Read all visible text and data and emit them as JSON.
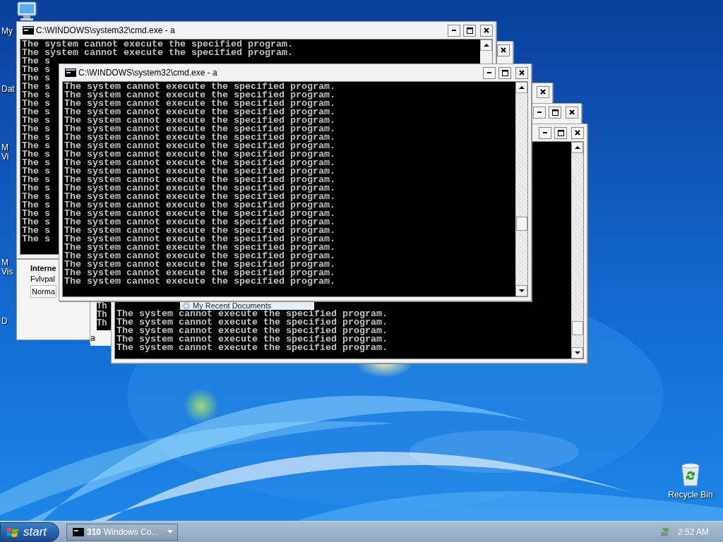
{
  "desktop": {
    "icon_labels": [
      {
        "lines": [
          "My"
        ]
      },
      {
        "lines": [
          "Dat"
        ]
      },
      {
        "lines": [
          "M",
          "Vi"
        ]
      },
      {
        "lines": [
          "M",
          "Vis"
        ]
      },
      {
        "lines": [
          "D"
        ]
      }
    ],
    "recycle_bin": {
      "label": "Recycle Bin"
    }
  },
  "windows": [
    {
      "buttons": [
        {
          "kind": "minimize"
        },
        {
          "kind": "maximize"
        },
        {
          "kind": "close"
        }
      ]
    },
    {
      "buttons": [
        {
          "kind": "close"
        }
      ]
    },
    {
      "buttons": [
        {
          "kind": "close"
        }
      ]
    },
    {
      "title": "C:\\WINDOWS\\system32\\cmd.exe - a",
      "buttons": [
        {
          "kind": "minimize"
        },
        {
          "kind": "maximize"
        },
        {
          "kind": "close"
        }
      ],
      "lines": [
        "The system cannot execute the specified program.",
        "The system cannot execute the specified program.",
        "The s",
        "The s",
        "The s",
        "The s",
        "The s",
        "The s",
        "The s",
        "The s",
        "The s",
        "The s",
        "The s",
        "The s",
        "The s",
        "The s",
        "The s",
        "The s",
        "The s",
        "The s",
        "The s",
        "The s",
        "The s",
        "The s"
      ]
    },
    {
      "buttons": [
        {
          "kind": "minimize"
        },
        {
          "kind": "maximize"
        },
        {
          "kind": "close"
        }
      ],
      "lines": [
        "The system cannot execute the specified program.",
        "The system cannot execute the specified program.",
        "The system cannot execute the specified program.",
        "The system cannot execute the specified program.",
        "The system cannot execute the specified program."
      ]
    },
    {
      "title": "C:\\WINDOWS\\system32\\cmd.exe - a",
      "buttons": [
        {
          "kind": "minimize"
        },
        {
          "kind": "maximize"
        },
        {
          "kind": "close"
        }
      ],
      "lines": [
        "The system cannot execute the specified program.",
        "The system cannot execute the specified program.",
        "The system cannot execute the specified program.",
        "The system cannot execute the specified program.",
        "The system cannot execute the specified program.",
        "The system cannot execute the specified program.",
        "The system cannot execute the specified program.",
        "The system cannot execute the specified program.",
        "The system cannot execute the specified program.",
        "The system cannot execute the specified program.",
        "The system cannot execute the specified program.",
        "The system cannot execute the specified program.",
        "The system cannot execute the specified program.",
        "The system cannot execute the specified program.",
        "The system cannot execute the specified program.",
        "The system cannot execute the specified program.",
        "The system cannot execute the specified program.",
        "The system cannot execute the specified program.",
        "The system cannot execute the specified program.",
        "The system cannot execute the specified program.",
        "The system cannot execute the specified program.",
        "The system cannot execute the specified program.",
        "The system cannot execute the specified program.",
        "The system cannot execute the specified program."
      ]
    }
  ],
  "browser_fragment": {
    "heading": "Interne",
    "label": "Fvlvpal",
    "field_value": "Norma"
  },
  "console_fragment": {
    "lines": [
      "Th",
      "Th",
      "Th"
    ],
    "caption": "a"
  },
  "menu_fragment": {
    "label": "My Recent Documents"
  },
  "taskbar": {
    "start": "start",
    "tasks": [
      {
        "count": "310",
        "label": "Windows Co..."
      }
    ],
    "clock": "2:52 AM"
  }
}
